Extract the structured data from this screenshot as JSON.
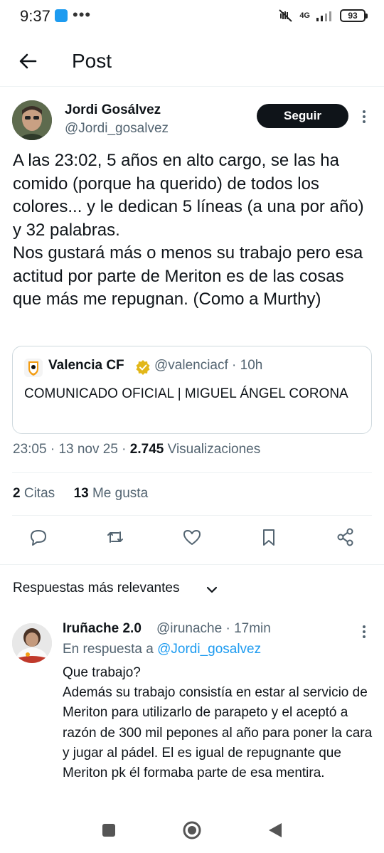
{
  "status_bar": {
    "time": "9:37",
    "dots": "•••",
    "network": "4G",
    "battery": "93"
  },
  "header": {
    "title": "Post"
  },
  "author": {
    "name": "Jordi Gosálvez",
    "handle": "@Jordi_gosalvez",
    "follow_label": "Seguir"
  },
  "tweet": {
    "text": "A las 23:02, 5 años en alto cargo, se las ha comido (porque ha querido) de todos los colores... y le dedican 5 líneas (a una por año) y 32 palabras.\nNos gustará más o menos su trabajo pero esa actitud por parte de Meriton es de las cosas que más me repugnan. (Como a Murthy)",
    "time": "23:05",
    "date": "13 nov 25",
    "views_count": "2.745",
    "views_label": "Visualizaciones"
  },
  "quote": {
    "name": "Valencia CF",
    "handle": "@valenciacf",
    "age": "10h",
    "text": "COMUNICADO OFICIAL | MIGUEL ÁNGEL CORONA"
  },
  "stats": {
    "quotes_count": "2",
    "quotes_label": "Citas",
    "likes_count": "13",
    "likes_label": "Me gusta"
  },
  "sort": {
    "label": "Respuestas más relevantes"
  },
  "reply": {
    "name": "Iruñache 2.0",
    "handle": "@irunache",
    "age": "17min",
    "in_reply_prefix": "En respuesta a",
    "in_reply_handle": "@Jordi_gosalvez",
    "text": "Que trabajo?\nAdemás su trabajo consistía en estar al servicio de Meriton para utilizarlo de parapeto y el aceptó a razón de 300 mil pepones al año para poner la cara y jugar al pádel. El es igual de repugnante que Meriton pk él formaba parte de esa mentira."
  },
  "colors": {
    "text": "#0f1419",
    "secondary": "#536471",
    "link": "#1d9bf0",
    "verified_gold": "#e2b719"
  }
}
